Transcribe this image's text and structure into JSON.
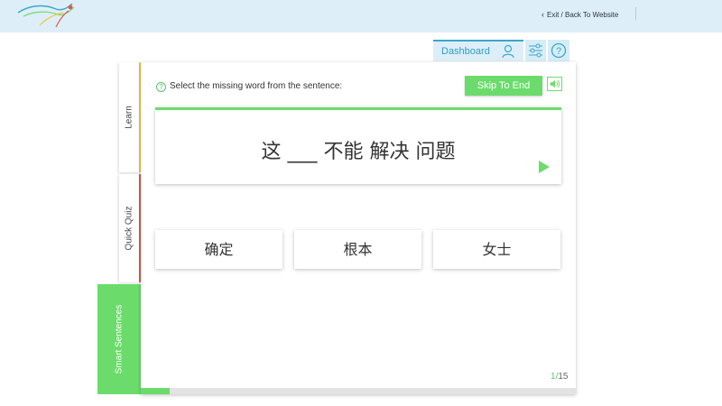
{
  "header": {
    "exit_label": "Exit / Back To Website"
  },
  "nav": {
    "dashboard_label": "Dashboard"
  },
  "side_tabs": [
    {
      "label": "Learn",
      "color": "#f2c744"
    },
    {
      "label": "Quick Quiz",
      "color": "#e3574a"
    },
    {
      "label": "Smart Sentences",
      "color": "#6bdc6b",
      "active": true
    }
  ],
  "quiz": {
    "instruction": "Select the missing word from the sentence:",
    "skip_label": "Skip To End",
    "sentence": "这 ___ 不能 解决 问题",
    "choices": [
      "确定",
      "根本",
      "女士"
    ],
    "current": "1",
    "separator": "/",
    "total": "15",
    "progress_fraction": 0.067
  },
  "colors": {
    "accent_green": "#6bdc6b",
    "header_bg": "#deeef8",
    "accent_blue": "#3aa7c9"
  },
  "icons": [
    "logo-bird-icon",
    "user-icon",
    "settings-sliders-icon",
    "help-icon",
    "sound-icon",
    "play-icon",
    "chevron-left-icon"
  ]
}
